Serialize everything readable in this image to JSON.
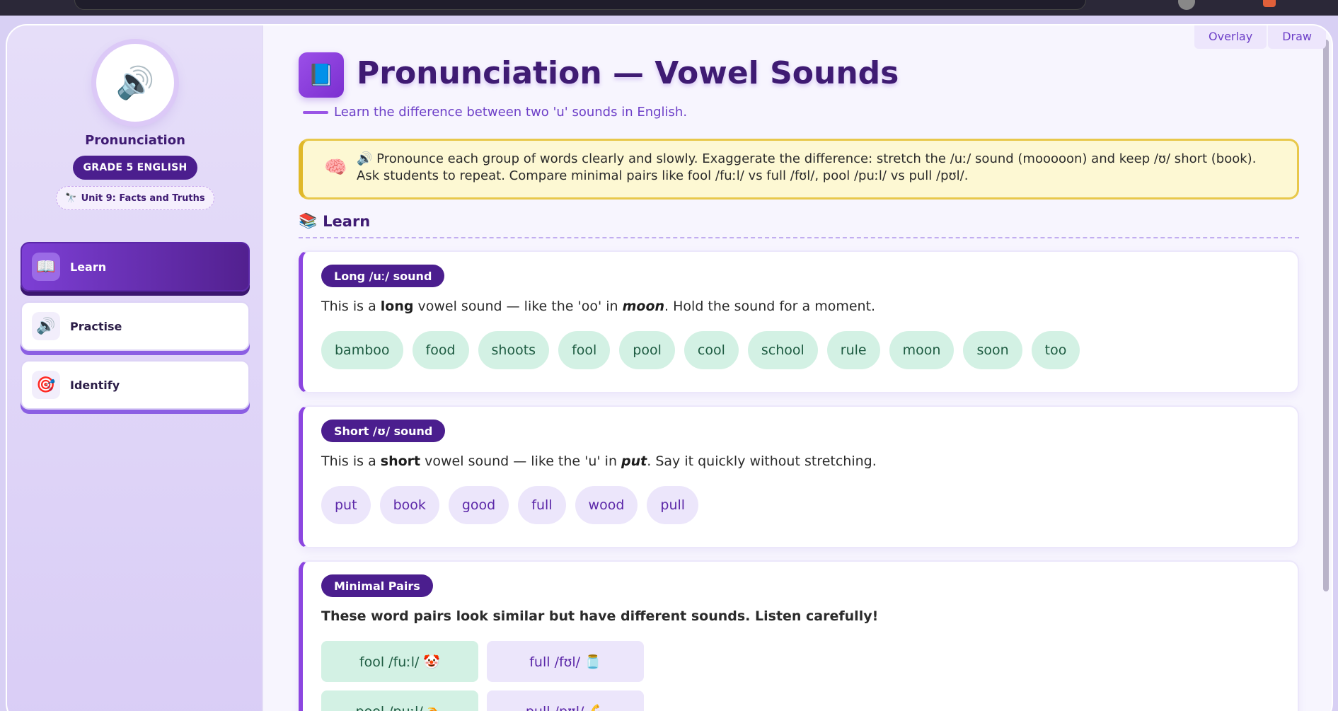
{
  "tools": {
    "overlay": "Overlay",
    "draw": "Draw"
  },
  "sidebar": {
    "logo_icon": "🔊",
    "app_name": "Pronunciation",
    "grade": "GRADE 5 ENGLISH",
    "unit_icon": "🔭",
    "unit": "Unit 9: Facts and Truths",
    "nav": [
      {
        "icon": "📖",
        "label": "Learn",
        "active": true
      },
      {
        "icon": "🔊",
        "label": "Practise",
        "active": false
      },
      {
        "icon": "🎯",
        "label": "Identify",
        "active": false
      }
    ]
  },
  "header": {
    "icon": "📘",
    "title": "Pronunciation — Vowel Sounds",
    "subtitle": "Learn the difference between two 'u' sounds in English."
  },
  "tip": {
    "icon": "🧠",
    "speaker": "🔊",
    "text": "Pronounce each group of words clearly and slowly. Exaggerate the difference: stretch the /uː/ sound (mooooon) and keep /ʊ/ short (book). Ask students to repeat. Compare minimal pairs like fool /fuːl/ vs full /fʊl/, pool /puːl/ vs pull /pʊl/."
  },
  "section": {
    "icon": "📚",
    "title": "Learn"
  },
  "long_card": {
    "tag": "Long /uː/ sound",
    "text_a": "This is a ",
    "text_bold": "long",
    "text_b": " vowel sound — like the 'oo' in ",
    "text_em": "moon",
    "text_c": ". Hold the sound for a moment.",
    "words": [
      "bamboo",
      "food",
      "shoots",
      "fool",
      "pool",
      "cool",
      "school",
      "rule",
      "moon",
      "soon",
      "too"
    ]
  },
  "short_card": {
    "tag": "Short /ʊ/ sound",
    "text_a": "This is a ",
    "text_bold": "short",
    "text_b": " vowel sound — like the 'u' in ",
    "text_em": "put",
    "text_c": ". Say it quickly without stretching.",
    "words": [
      "put",
      "book",
      "good",
      "full",
      "wood",
      "pull"
    ]
  },
  "pairs_card": {
    "tag": "Minimal Pairs",
    "text": "These word pairs look similar but have different sounds. Listen carefully!",
    "pairs": [
      {
        "long": "fool /fuːl/ 🤡",
        "short": "full /fʊl/ 🫙"
      },
      {
        "long": "pool /puːl/ 🏊",
        "short": "pull /pʊl/ 💪"
      }
    ]
  }
}
